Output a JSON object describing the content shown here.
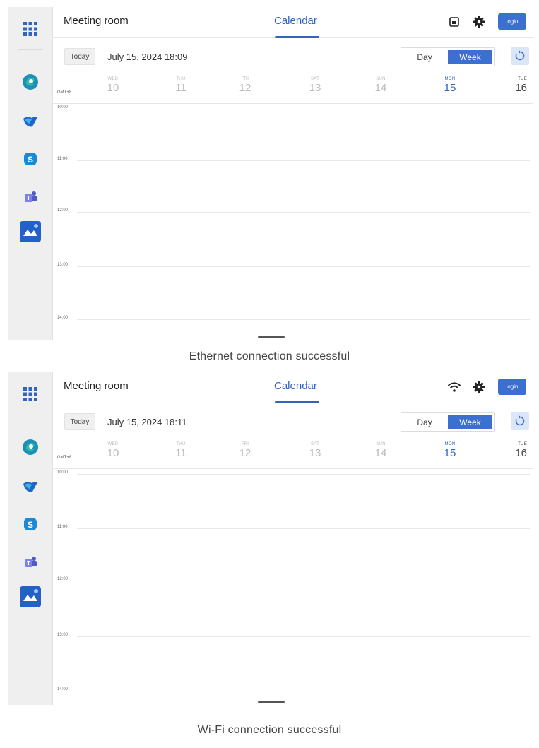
{
  "colors": {
    "accent": "#2f64bf",
    "button": "#3b6fd0",
    "sidebar_bg": "#efefef"
  },
  "sidebar": {
    "items": [
      {
        "icon": "apps-grid-icon"
      },
      {
        "icon": "edge-browser-icon"
      },
      {
        "icon": "whiteboard-app-icon"
      },
      {
        "icon": "skype-icon"
      },
      {
        "icon": "teams-icon"
      },
      {
        "icon": "meeting-app-icon"
      }
    ]
  },
  "panels": [
    {
      "header": {
        "room": "Meeting room",
        "tab": "Calendar",
        "connection_icon": "ethernet-icon",
        "login_label": "login"
      },
      "toolbar": {
        "today_label": "Today",
        "datetime": "July 15, 2024 18:09",
        "view_day": "Day",
        "view_week": "Week"
      },
      "calendar": {
        "timezone": "GMT+8",
        "days": [
          {
            "name": "WED",
            "date": "10"
          },
          {
            "name": "THU",
            "date": "11"
          },
          {
            "name": "FRI",
            "date": "12"
          },
          {
            "name": "SAT",
            "date": "13"
          },
          {
            "name": "SUN",
            "date": "14"
          },
          {
            "name": "MON",
            "date": "15"
          },
          {
            "name": "TUE",
            "date": "16"
          }
        ],
        "hours": [
          "10:00",
          "11:00",
          "12:00",
          "13:00",
          "14:00"
        ]
      },
      "caption": "Ethernet connection successful"
    },
    {
      "header": {
        "room": "Meeting room",
        "tab": "Calendar",
        "connection_icon": "wifi-icon",
        "login_label": "login"
      },
      "toolbar": {
        "today_label": "Today",
        "datetime": "July 15, 2024 18:11",
        "view_day": "Day",
        "view_week": "Week"
      },
      "calendar": {
        "timezone": "GMT+8",
        "days": [
          {
            "name": "WED",
            "date": "10"
          },
          {
            "name": "THU",
            "date": "11"
          },
          {
            "name": "FRI",
            "date": "12"
          },
          {
            "name": "SAT",
            "date": "13"
          },
          {
            "name": "SUN",
            "date": "14"
          },
          {
            "name": "MON",
            "date": "15"
          },
          {
            "name": "TUE",
            "date": "16"
          }
        ],
        "hours": [
          "10:00",
          "11:00",
          "12:00",
          "13:00",
          "14:00"
        ]
      },
      "caption": "Wi-Fi connection successful"
    }
  ]
}
